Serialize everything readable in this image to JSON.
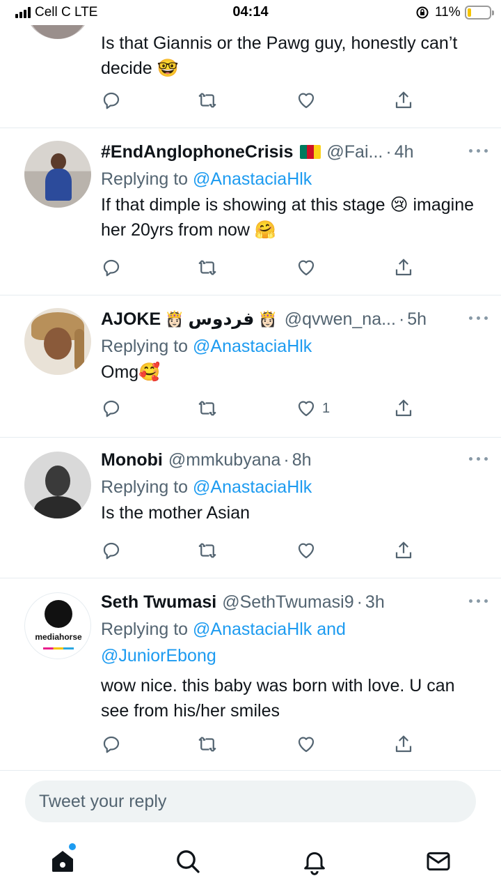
{
  "status_bar": {
    "carrier": "Cell C  LTE",
    "time": "04:14",
    "battery": "11%"
  },
  "tweets": [
    {
      "name": "",
      "handle": "",
      "time": "",
      "replying_prefix": "",
      "mentions": "",
      "text": "Is that Giannis or the Pawg guy, honestly can’t decide 🤓",
      "likes": ""
    },
    {
      "name": "#EndAnglophoneCrisis",
      "handle": "@Fai...",
      "time": "4h",
      "replying_prefix": "Replying to",
      "mentions": "@AnastaciaHlk",
      "text": "If that dimple is showing at this stage 😢 imagine her 20yrs from now 🤗",
      "likes": ""
    },
    {
      "name": "AJOKE",
      "name_extra": "فردوس",
      "crown_emoji": "👸🏻",
      "handle": "@qvwen_na...",
      "time": "5h",
      "replying_prefix": "Replying to",
      "mentions": "@AnastaciaHlk",
      "text": "Omg🥰",
      "likes": "1"
    },
    {
      "name": "Monobi",
      "handle": "@mmkubyana",
      "time": "8h",
      "replying_prefix": "Replying to",
      "mentions": "@AnastaciaHlk",
      "text": "Is the mother  Asian",
      "likes": ""
    },
    {
      "name": "Seth Twumasi",
      "handle": "@SethTwumasi9",
      "time": "3h",
      "replying_prefix": "Replying to",
      "mentions": "@AnastaciaHlk and @JuniorEbong",
      "avatar_logo_text": "mediahorse",
      "text": "wow nice. this baby was born with love. U can see from his/her smiles",
      "likes": ""
    }
  ],
  "reply_input": {
    "placeholder": "Tweet your reply"
  },
  "tabbar": [
    "home-icon",
    "search-icon",
    "bell-icon",
    "mail-icon"
  ],
  "colors": {
    "accent": "#1d9bf0",
    "secondary_text": "#536471",
    "divider": "#e6ecf0"
  }
}
